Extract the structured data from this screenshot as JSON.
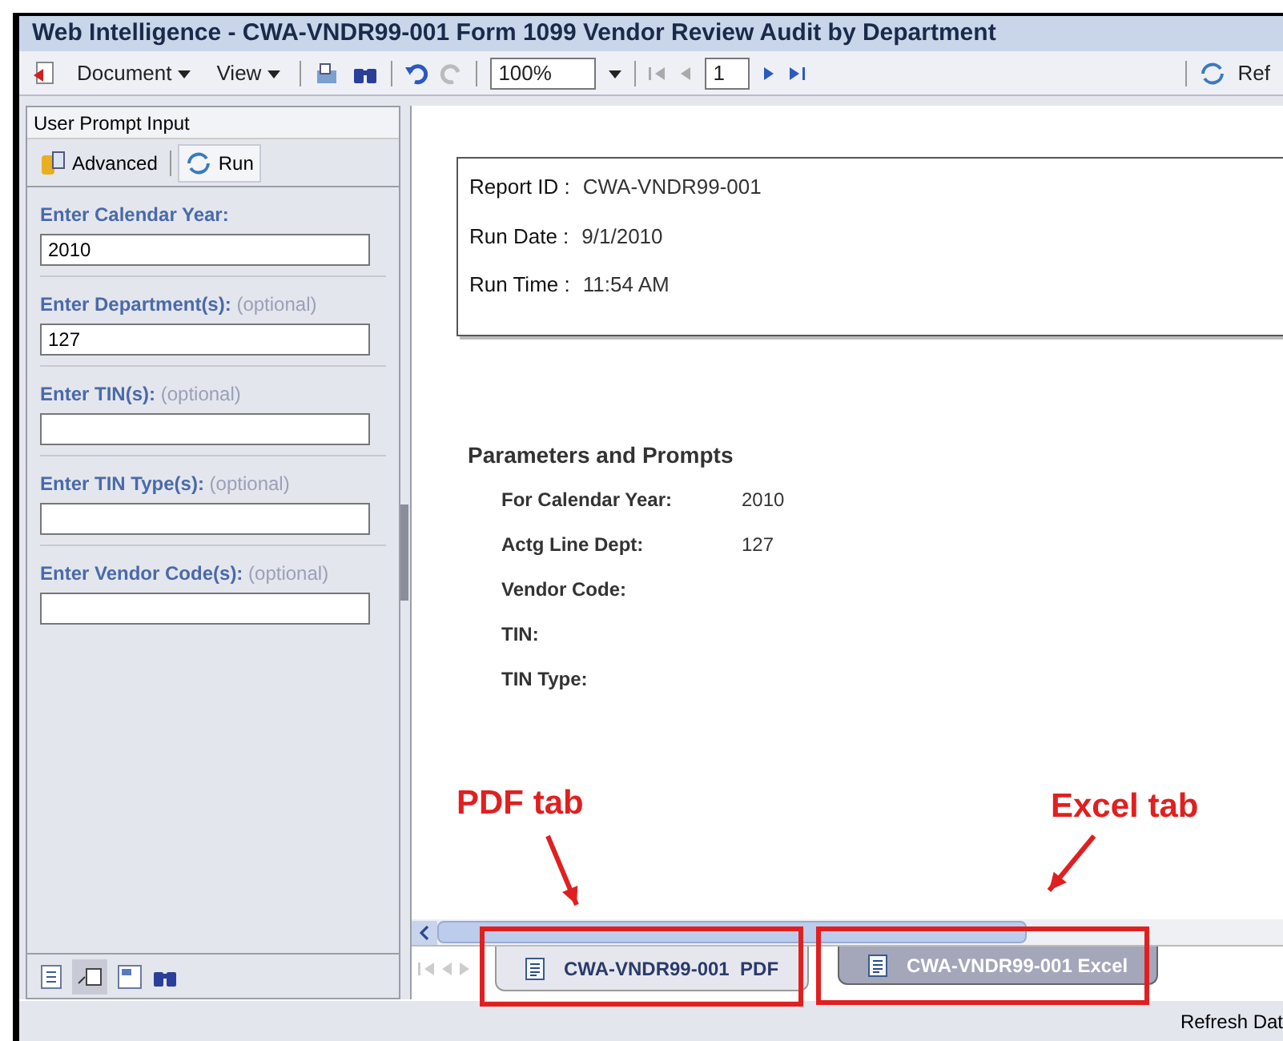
{
  "window": {
    "title": "Web Intelligence - CWA-VNDR99-001 Form 1099 Vendor Review Audit by Department"
  },
  "toolbar": {
    "menus": [
      "Document",
      "View"
    ],
    "zoom": "100%",
    "page": "1",
    "refresh": "Ref"
  },
  "prompt_panel": {
    "title": "User Prompt Input",
    "buttons": [
      "Advanced",
      "Run"
    ],
    "prompts": [
      {
        "label": "Enter Calendar Year:",
        "value": "2010"
      },
      {
        "label": "Enter Department(s):",
        "hint": "(optional)",
        "value": "127"
      },
      {
        "label": "Enter TIN(s):",
        "hint": "(optional)"
      },
      {
        "label": "Enter TIN Type(s):",
        "hint": "(optional)"
      },
      {
        "label": "Enter Vendor Code(s):",
        "hint": "(optional)"
      }
    ]
  },
  "report": {
    "header": [
      {
        "label": "Report ID :",
        "value": "CWA-VNDR99-001"
      },
      {
        "label": "Run Date :",
        "value": "9/1/2010"
      },
      {
        "label": "Run Time :",
        "value": "11:54 AM"
      }
    ],
    "params_title": "Parameters and Prompts",
    "params": [
      {
        "label": "For Calendar Year:",
        "value": "2010"
      },
      {
        "label": "Actg Line Dept:",
        "value": "127"
      },
      {
        "label": "Vendor Code:"
      },
      {
        "label": "TIN:"
      },
      {
        "label": "TIN Type:"
      }
    ]
  },
  "tabs": [
    {
      "label": "CWA-VNDR99-001  PDF",
      "selected": true
    },
    {
      "label": "CWA-VNDR99-001 Excel",
      "selected": false
    }
  ],
  "annotations": [
    "PDF tab",
    "Excel tab"
  ],
  "status_bar": {
    "text": "Refresh Dat"
  }
}
